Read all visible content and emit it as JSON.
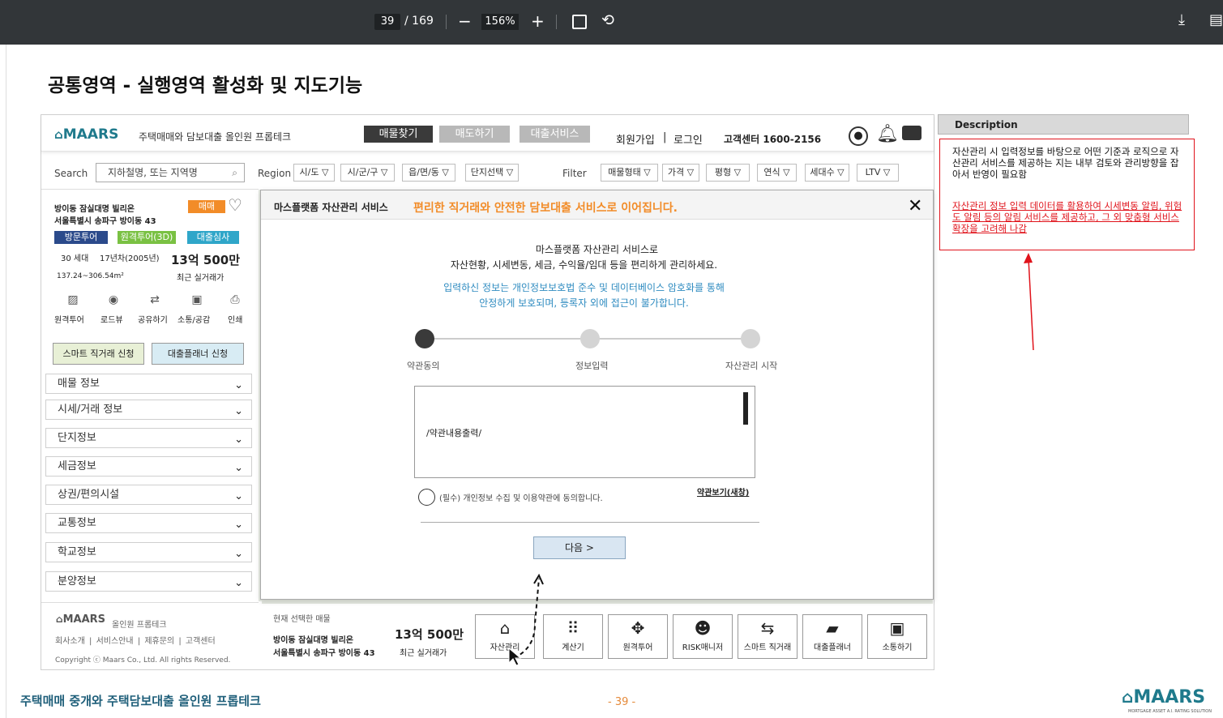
{
  "viewer": {
    "page_current": "39",
    "page_total": "/ 169",
    "zoom": "156%"
  },
  "slide": {
    "title": "공통영역 - 실행영역 활성화 및 지도기능",
    "footer_left": "주택매매 중개와 주택담보대출 올인원 프롭테크",
    "footer_page": "- 39 -",
    "footer_logo_sub": "MORTGAGE ASSET A.I. RATING SOLUTION"
  },
  "header": {
    "logo": "MAARS",
    "tagline": "주택매매와 담보대출 올인원 프롭테크",
    "nav": [
      "매물찾기",
      "매도하기",
      "대출서비스"
    ],
    "signup": "회원가입",
    "divider": "|",
    "login": "로그인",
    "cs_label": "고객센터 1600-2156"
  },
  "searchbar": {
    "search_label": "Search",
    "search_placeholder": "지하철명, 또는 지역명",
    "region_label": "Region",
    "region_selects": [
      "시/도 ▽",
      "시/군/구 ▽",
      "읍/면/동 ▽",
      "단지선택 ▽"
    ],
    "filter_label": "Filter",
    "filters": [
      "매물형태 ▽",
      "가격 ▽",
      "평형 ▽",
      "연식 ▽",
      "세대수 ▽",
      "LTV ▽"
    ]
  },
  "listing": {
    "name_line1": "방이동 잠실대명 빌리온",
    "name_line2": "서울특별시 송파구 방이동 43",
    "tag": "매매",
    "badges": [
      "방문투어",
      "원격투어(3D)",
      "대출심사"
    ],
    "households": "30 세대",
    "year": "17년차(2005년)",
    "price": "13억 500만",
    "area": "137.24~306.54m²",
    "price_label": "최근 실거래가",
    "actions": [
      "원격투어",
      "로드뷰",
      "공유하기",
      "소통/공감",
      "인쇄"
    ],
    "btn_direct": "스마트 직거래 신청",
    "btn_planner": "대출플래너 신청"
  },
  "accordion": [
    "매물 정보",
    "시세/거래 정보",
    "단지정보",
    "세금정보",
    "상권/편의시설",
    "교통정보",
    "학교정보",
    "분양정보"
  ],
  "footer": {
    "logo": "MAARS",
    "sub": "올인원 프롭테크",
    "links": [
      "회사소개",
      "|",
      "서비스안내",
      "|",
      "제휴문의",
      "|",
      "고객센터"
    ],
    "copyright": "Copyright ⓒ Maars Co., Ltd. All rights Reserved."
  },
  "modal": {
    "title": "마스플랫폼 자산관리 서비스",
    "subtitle": "편리한 직거래와 안전한 담보대출 서비스로 이어집니다.",
    "desc1": "마스플랫폼 자산관리 서비스로",
    "desc2": "자산현황, 시세변동, 세금, 수익율/임대 등을 편리하게 관리하세요.",
    "notice1": "입력하신 정보는 개인정보보호법 준수 및 데이터베이스 암호화를 통해",
    "notice2": "안정하게 보호되며, 등록자 외에 접근이 불가합니다.",
    "steps": [
      "약관동의",
      "정보입력",
      "자산관리 시작"
    ],
    "terms_placeholder": "/약관내용출력/",
    "consent": "(필수) 개인정보 수집 및 이용약관에 동의합니다.",
    "terms_link": "약관보기(새창)",
    "next": "다음 >"
  },
  "bottombar": {
    "selected_label": "현재 선택한 매물",
    "name_line1": "방이동 잠실대명 빌리온",
    "name_line2": "서울특별시 송파구 방이동 43",
    "price": "13억 500만",
    "price_label": "최근 실거래가",
    "tiles": [
      "자산관리",
      "계산기",
      "원격투어",
      "RISK매니저",
      "스마트 직거래",
      "대출플래너",
      "소통하기"
    ]
  },
  "description": {
    "header": "Description",
    "text1": "자산관리 시 입력정보를 바탕으로 어떤 기준과 로직으로 자산관리 서비스를 제공하는 지는 내부 검토와 관리방향을 잡아서 반영이 필요함",
    "text2": "자산관리 정보 입력 데이터를 활용하여 시세변동 알림, 위험도 알림 등의 알림 서비스를 제공하고, 그 외 맞춤형 서비스 확장을 고려해 나감"
  },
  "colors": {
    "brand_teal": "#1f7a8c",
    "orange": "#f28c28",
    "modal_blue": "#2e8bc0",
    "annotation_red": "#e0131b",
    "dark_nav": "#3a3a3a"
  }
}
